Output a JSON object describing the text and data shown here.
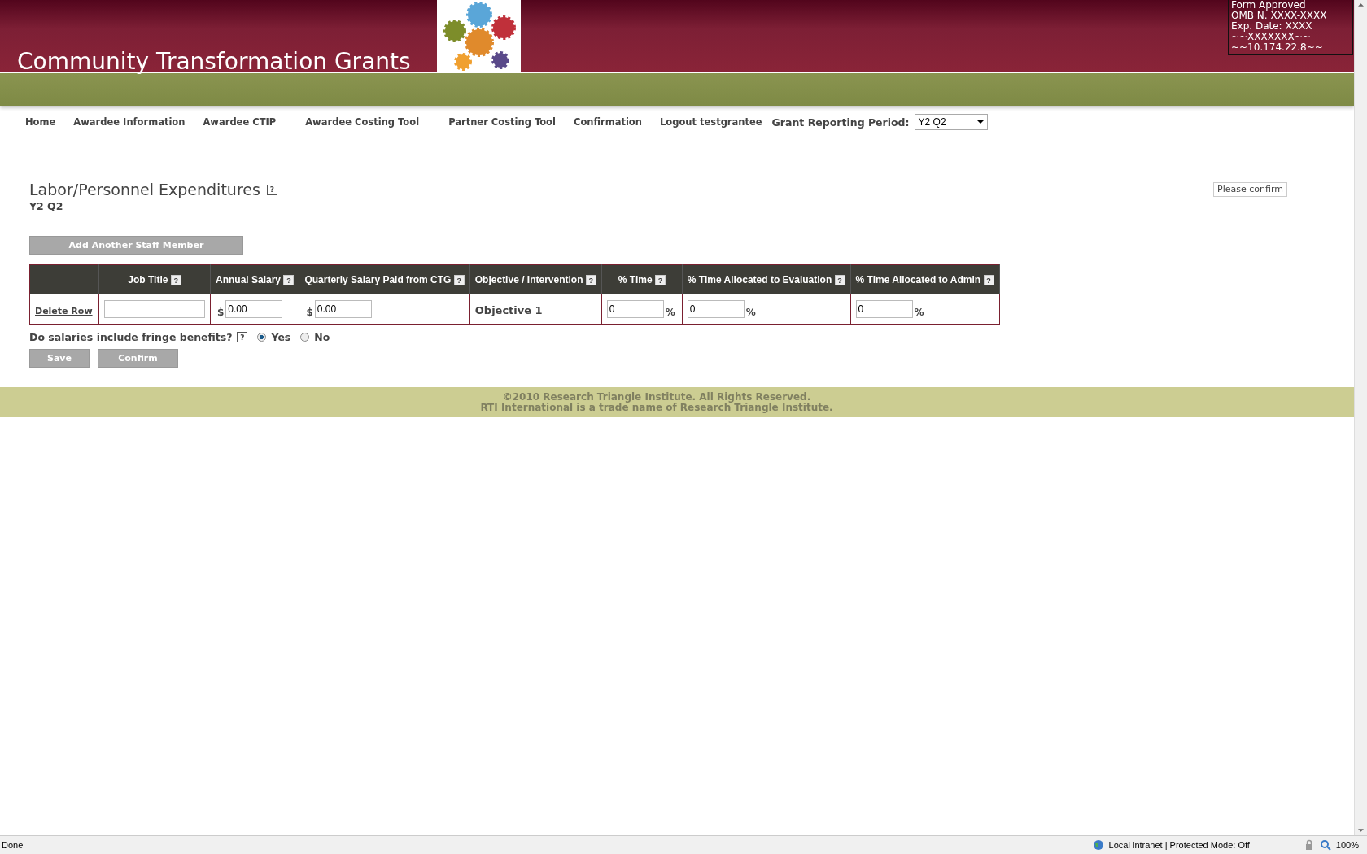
{
  "header": {
    "title": "Community Transformation Grants",
    "form_info": [
      "Form Approved",
      "OMB N. XXXX-XXXX",
      "Exp. Date: XXXX",
      "~~XXXXXXX~~",
      "~~10.174.22.8~~"
    ]
  },
  "nav": {
    "items": [
      {
        "label": "Home"
      },
      {
        "label": "Awardee Information"
      },
      {
        "label": "Awardee CTIP"
      },
      {
        "label": "Awardee Costing Tool"
      },
      {
        "label": "Partner Costing Tool"
      },
      {
        "label": "Confirmation"
      },
      {
        "label": "Logout testgrantee"
      }
    ],
    "period_label": "Grant Reporting Period:",
    "period_value": "Y2 Q2"
  },
  "page": {
    "heading": "Labor/Personnel Expenditures",
    "heading_help": "?",
    "subheading": "Y2 Q2",
    "confirm_note": "Please confirm",
    "add_button": "Add Another Staff Member"
  },
  "table": {
    "columns": [
      {
        "label": "Job Title",
        "help": "?"
      },
      {
        "label": "Annual Salary",
        "help": "?"
      },
      {
        "label": "Quarterly Salary Paid from CTG",
        "help": "?"
      },
      {
        "label": "Objective / Intervention",
        "help": "?"
      },
      {
        "label": "% Time",
        "help": "?"
      },
      {
        "label": "% Time Allocated to Evaluation",
        "help": "?"
      },
      {
        "label": "% Time Allocated to Admin",
        "help": "?"
      }
    ],
    "rows": [
      {
        "action": "Delete Row",
        "cells": [
          {
            "kind": "input"
          },
          {
            "kind": "money",
            "prefix": "$",
            "value": "0.00"
          },
          {
            "kind": "money",
            "prefix": "$",
            "value": "0.00"
          },
          {
            "kind": "text",
            "value": "Objective 1"
          },
          {
            "kind": "percent",
            "value": "0",
            "suffix": "%"
          },
          {
            "kind": "percent",
            "value": "0",
            "suffix": "%"
          },
          {
            "kind": "percent",
            "value": "0",
            "suffix": "%"
          }
        ]
      }
    ]
  },
  "fringe": {
    "question": "Do salaries include fringe benefits?",
    "help": "?",
    "options": [
      {
        "label": "Yes",
        "selected": true
      },
      {
        "label": "No",
        "selected": false
      }
    ]
  },
  "buttons": [
    "Save",
    "Confirm"
  ],
  "footer": [
    "©2010 Research Triangle Institute. All Rights Reserved.",
    "RTI International is a trade name of Research Triangle Institute."
  ],
  "status_bar": {
    "status": "Done",
    "zone": "Local intranet | Protected Mode: Off",
    "zoom": "100%"
  }
}
